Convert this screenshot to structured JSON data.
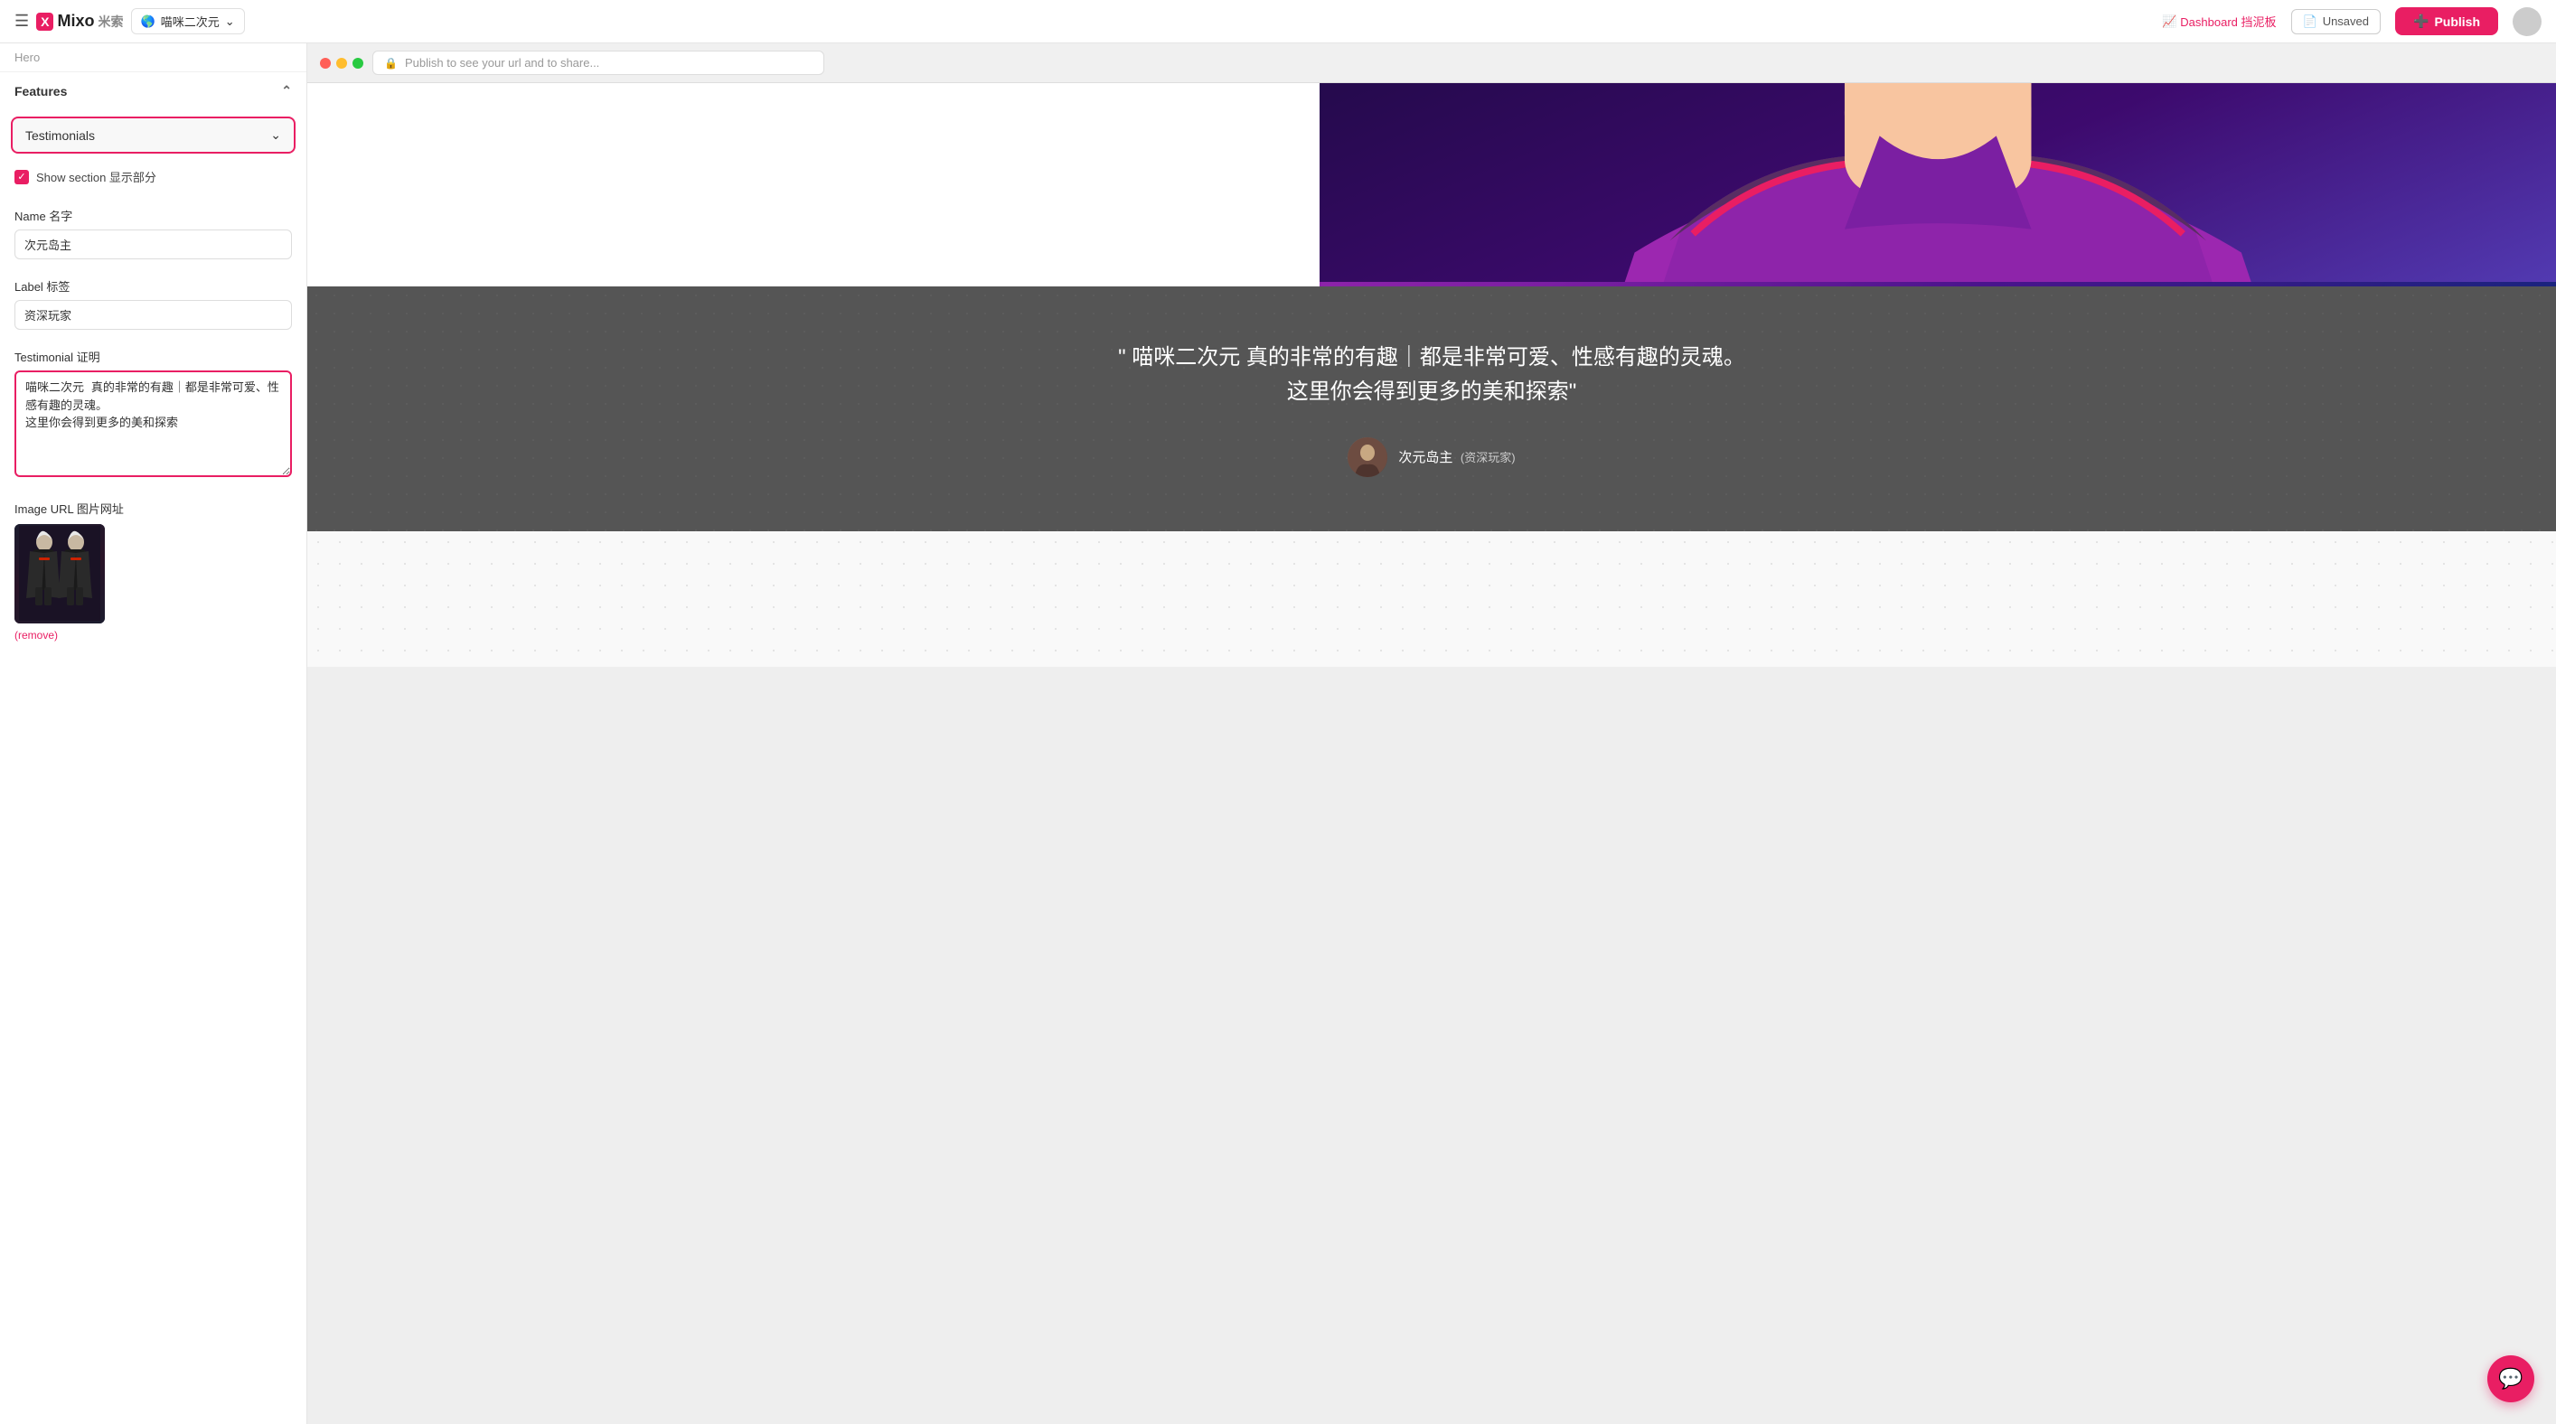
{
  "nav": {
    "brand_x": "X",
    "brand_name": "Mixo",
    "brand_cn": "米索",
    "site_name": "喵咪二次元",
    "dashboard_label": "Dashboard 挡泥板",
    "unsaved_label": "Unsaved",
    "publish_label": "Publish"
  },
  "sidebar": {
    "section_label": "Hero",
    "features_label": "Features",
    "selected_item": "Testimonials",
    "show_section_label": "Show section 显示部分",
    "name_label": "Name 名字",
    "name_value": "次元岛主",
    "label_label": "Label 标签",
    "label_value": "资深玩家",
    "testimonial_label": "Testimonial 证明",
    "testimonial_value": "喵咪二次元 真的非常的有趣｜都是非常可爱、性感有趣的灵魂。\n这里你会得到更多的美和探索",
    "image_url_label": "Image URL 图片网址",
    "remove_label": "(remove)"
  },
  "preview": {
    "url_placeholder": "Publish to see your url and to share...",
    "testimonial_quote": "\" 喵咪二次元 真的非常的有趣｜都是非常可爱、性感有趣的灵魂。 这里你会得到更多的美和探索\"",
    "author_name": "次元岛主",
    "author_label": "(资深玩家)"
  },
  "chat_icon": "💬"
}
